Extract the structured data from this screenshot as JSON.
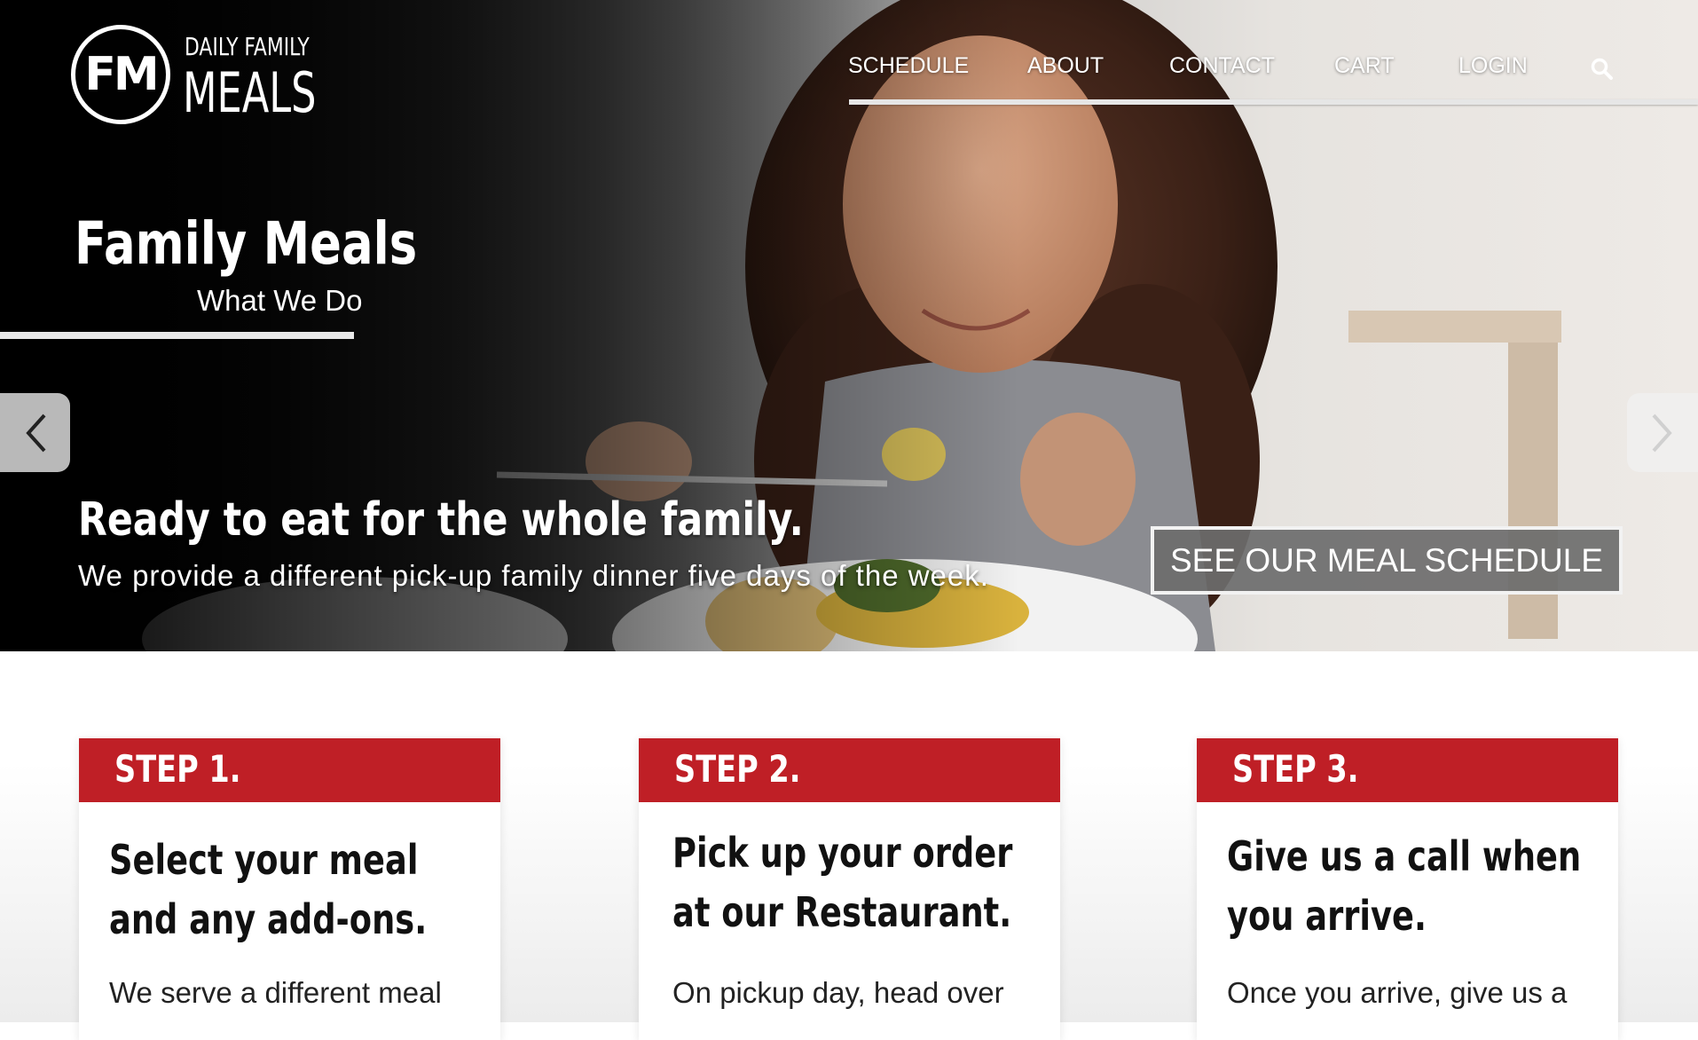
{
  "brand": {
    "logo_initials": "FM",
    "logo_top": "DAILY FAMILY",
    "logo_main": "MEALS"
  },
  "nav": {
    "items": [
      "SCHEDULE",
      "ABOUT",
      "CONTACT",
      "CART",
      "LOGIN"
    ],
    "search_icon": "search-icon"
  },
  "hero": {
    "title": "Family Meals",
    "subtitle": "What We Do",
    "tagline": "Ready to eat for the whole family.",
    "tagline_sub": "We provide a different pick-up family dinner five days of the week.",
    "cta_label": "SEE OUR MEAL SCHEDULE",
    "prev_icon": "chevron-left-icon",
    "next_icon": "chevron-right-icon"
  },
  "steps": [
    {
      "label": "STEP 1.",
      "title_lines": [
        "Select your meal",
        "and any add-ons."
      ],
      "body": "We serve a different meal"
    },
    {
      "label": "STEP 2.",
      "title_lines": [
        "Pick up your order",
        "at our Restaurant."
      ],
      "body": "On pickup day, head over"
    },
    {
      "label": "STEP 3.",
      "title_lines": [
        "Give us a call when",
        "you arrive."
      ],
      "body": "Once you arrive, give us a"
    }
  ],
  "colors": {
    "accent_red": "#bf1f26",
    "cta_bg": "#6c6c6c",
    "text_dark": "#111111"
  }
}
